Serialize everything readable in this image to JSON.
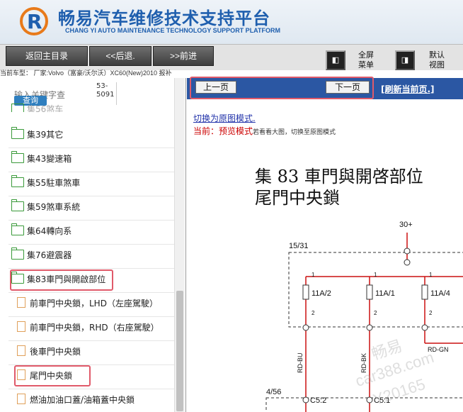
{
  "header": {
    "title": "畅易汽车维修技术支持平台",
    "subtitle": "CHANG YI AUTO MAINTENANCE TECHNOLOGY SUPPORT PLATFORM",
    "accent": "#1f5fae"
  },
  "toolbar": {
    "home": "返回主目录",
    "back": "<<后退.",
    "forward": ">>前进",
    "fullscreen_line1": "全屏",
    "fullscreen_line2": "菜单",
    "default_line1": "默认",
    "default_line2": "视图"
  },
  "vehicle_info": "当前车型： 厂家:Volvo（富豪/沃尔沃）XC60(New)2010 报补",
  "search": {
    "placeholder": "输入关键字查",
    "code_line1": "53-",
    "code_line2": "5091",
    "button": "查询"
  },
  "tree": {
    "partial_top": "集56煞车",
    "folders": [
      "集39其它",
      "集43變速箱",
      "集55駐車煞車",
      "集59煞車系統",
      "集64轉向系",
      "集76避震器",
      "集83車門與開啟部位"
    ],
    "docs": [
      "前車門中央鎖，LHD（左座駕駛）",
      "前車門中央鎖，RHD（右座駕駛）",
      "後車門中央鎖",
      "尾門中央鎖",
      "燃油加油口蓋/油箱蓋中央鎖"
    ]
  },
  "viewer": {
    "prev": "上一页",
    "next": "下一页",
    "refresh": "[刷新当前页.]",
    "switch_link": "切换为原图模式.",
    "mode_prefix": "当前：预览模式",
    "mode_hint": "若看看大图，切换至原图模式",
    "diagram_title_line1": "集 83 車門與開啓部位",
    "diagram_title_line2": "尾門中央鎖"
  },
  "diagram": {
    "labels": [
      "30+",
      "15/31",
      "11A/2",
      "11A/1",
      "11A/4",
      "RD-BU",
      "RD-BK",
      "RD-GN",
      "4/56",
      "C5:2",
      "C5:1"
    ],
    "pins": [
      "1",
      "1",
      "1",
      "2",
      "2",
      "2"
    ]
  },
  "watermark": [
    "畅易",
    "car388.com",
    "Y20165"
  ]
}
